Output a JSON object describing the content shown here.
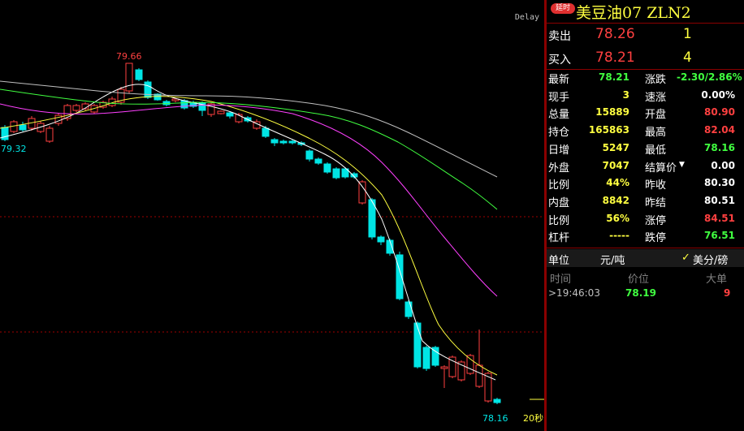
{
  "chart": {
    "delay_label": "Delay",
    "high_label": "79.66",
    "left_label": "79.32",
    "low_label": "78.16",
    "interval_label": "20秒",
    "colors": {
      "up": "#ff4040",
      "down": "#00e5e5",
      "ma1": "#ffffff",
      "ma2": "#ffff40",
      "ma3": "#ff40ff",
      "ma4": "#40ff40",
      "ma5": "#c0c0c0",
      "grid": "#a00000"
    }
  },
  "header": {
    "badge": "延时",
    "title": "美豆油07  ZLN2"
  },
  "quotes": {
    "sell_label": "卖出",
    "sell_price": "78.26",
    "sell_vol": "1",
    "buy_label": "买入",
    "buy_price": "78.21",
    "buy_vol": "4"
  },
  "stats": [
    {
      "l1": "最新",
      "v1": "78.21",
      "c1": "green",
      "l2": "涨跌",
      "v2": "-2.30/2.86%",
      "c2": "green"
    },
    {
      "l1": "现手",
      "v1": "3",
      "c1": "yellow",
      "l2": "速涨",
      "v2": "0.00%",
      "c2": "white"
    },
    {
      "l1": "总量",
      "v1": "15889",
      "c1": "yellow",
      "l2": "开盘",
      "v2": "80.90",
      "c2": "red"
    },
    {
      "l1": "持仓",
      "v1": "165863",
      "c1": "yellow",
      "l2": "最高",
      "v2": "82.04",
      "c2": "red"
    },
    {
      "l1": "日增",
      "v1": "5247",
      "c1": "yellow",
      "l2": "最低",
      "v2": "78.16",
      "c2": "green"
    },
    {
      "l1": "外盘",
      "v1": "7047",
      "c1": "yellow",
      "l2": "结算价",
      "v2": "0.00",
      "c2": "white"
    },
    {
      "l1": "比例",
      "v1": "44%",
      "c1": "yellow",
      "l2": "昨收",
      "v2": "80.30",
      "c2": "white"
    },
    {
      "l1": "内盘",
      "v1": "8842",
      "c1": "yellow",
      "l2": "昨结",
      "v2": "80.51",
      "c2": "white"
    },
    {
      "l1": "比例",
      "v1": "56%",
      "c1": "yellow",
      "l2": "涨停",
      "v2": "84.51",
      "c2": "red"
    },
    {
      "l1": "杠杆",
      "v1": "-----",
      "c1": "yellow",
      "l2": "跌停",
      "v2": "76.51",
      "c2": "green"
    }
  ],
  "unit": {
    "label": "单位",
    "value": "元/吨",
    "check": "✓",
    "option": "美分/磅"
  },
  "ticks": {
    "headers": [
      "时间",
      "价位",
      "大单"
    ],
    "rows": [
      {
        "time": ">19:46:03",
        "price": "78.19",
        "size": "9"
      }
    ]
  }
}
